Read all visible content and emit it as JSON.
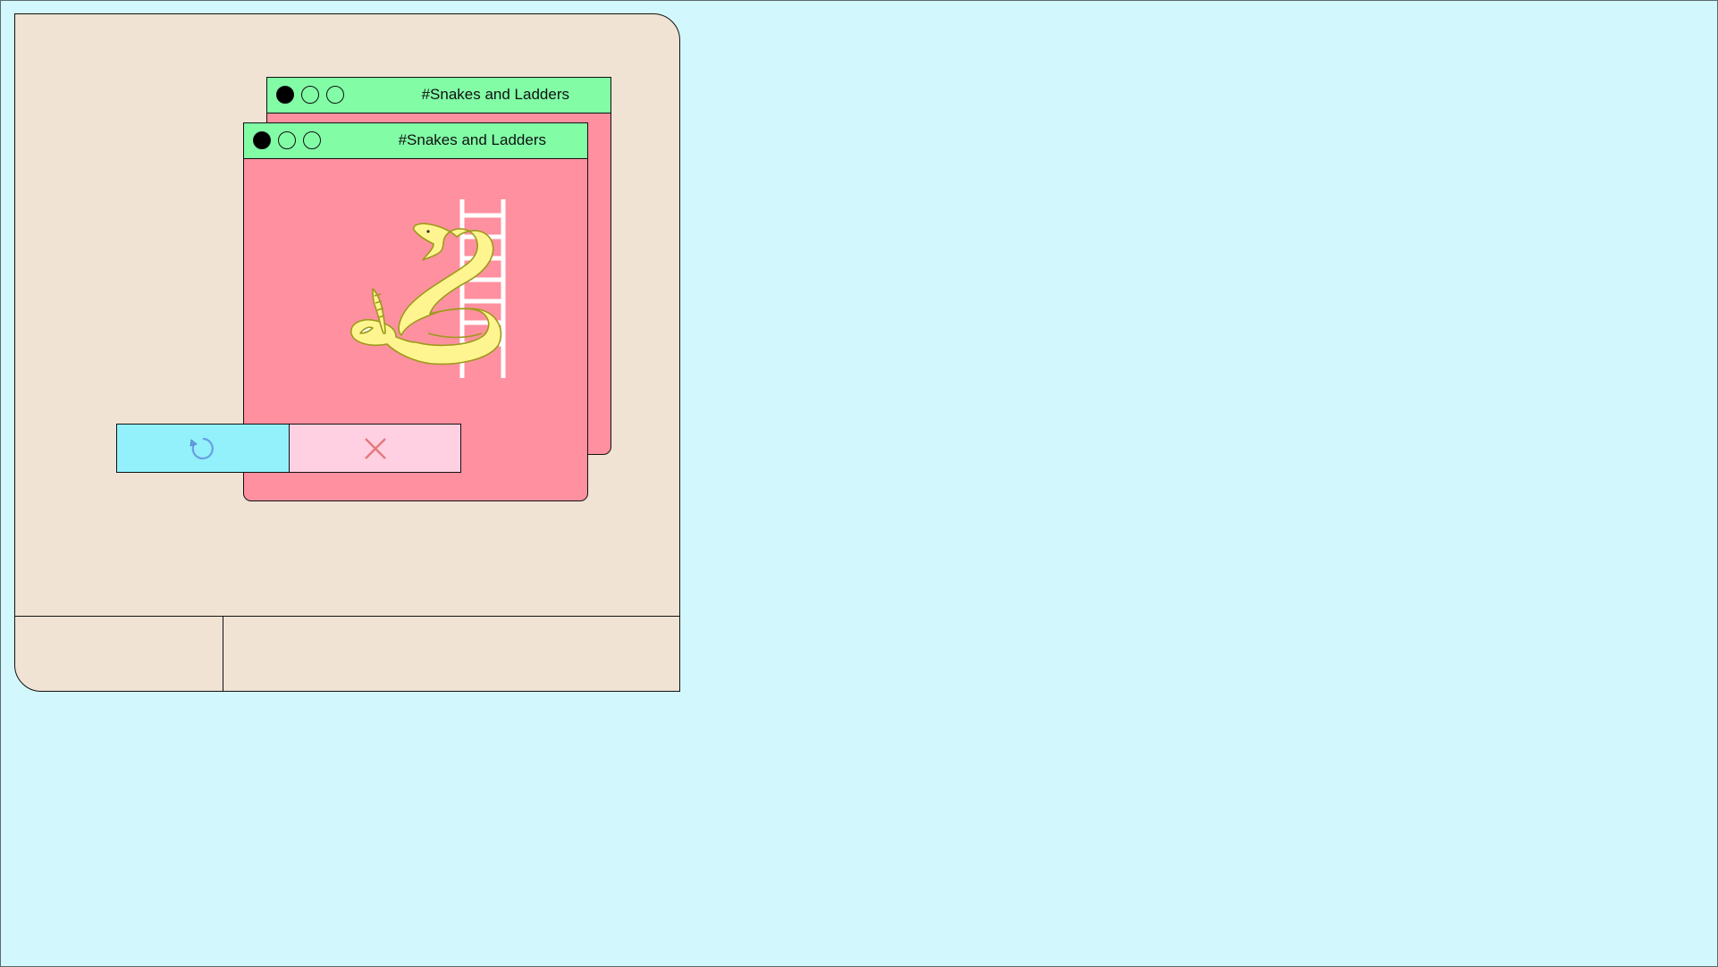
{
  "desktop": {
    "background_color": "#d2f8fd",
    "panel_color": "#f0e3d4"
  },
  "windows": [
    {
      "title": "#Snakes and Ladders",
      "titlebar_color": "#82fda6",
      "body_color": "#ff909f"
    },
    {
      "title": "#Snakes and Ladders",
      "titlebar_color": "#82fda6",
      "body_color": "#ff909f"
    }
  ],
  "illustration": {
    "icons": [
      "ladder-icon",
      "snake-icon"
    ]
  },
  "dialog_buttons": {
    "restart": {
      "icon": "restart-icon",
      "color": "#92f1fb"
    },
    "close": {
      "icon": "close-icon",
      "color": "#ffd0e2"
    }
  }
}
